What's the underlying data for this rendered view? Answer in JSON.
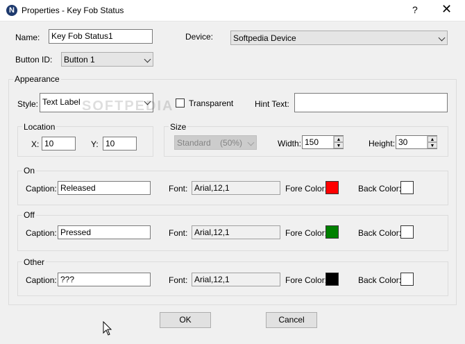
{
  "window": {
    "title": "Properties - Key Fob Status",
    "app_icon_letter": "N",
    "help_glyph": "?",
    "close_glyph": "✕"
  },
  "general": {
    "name_label": "Name:",
    "name_value": "Key Fob Status1",
    "device_label": "Device:",
    "device_value": "Softpedia Device",
    "button_id_label": "Button ID:",
    "button_id_value": "Button 1"
  },
  "appearance": {
    "title": "Appearance",
    "style_label": "Style:",
    "style_value": "Text Label",
    "transparent_label": "Transparent",
    "transparent_checked": false,
    "hint_label": "Hint Text:",
    "hint_value": ""
  },
  "location": {
    "title": "Location",
    "x_label": "X:",
    "x_value": "10",
    "y_label": "Y:",
    "y_value": "10"
  },
  "size": {
    "title": "Size",
    "preset_value": "Standard    (50%)",
    "width_label": "Width:",
    "width_value": "150",
    "height_label": "Height:",
    "height_value": "30"
  },
  "states": [
    {
      "title": "On",
      "caption_label": "Caption:",
      "caption_value": "Released",
      "font_label": "Font:",
      "font_value": "Arial,12,1",
      "fore_label": "Fore Color:",
      "fore_color": "#ff0000",
      "back_label": "Back Color:",
      "back_color": "#ffffff"
    },
    {
      "title": "Off",
      "caption_label": "Caption:",
      "caption_value": "Pressed",
      "font_label": "Font:",
      "font_value": "Arial,12,1",
      "fore_label": "Fore Color:",
      "fore_color": "#008000",
      "back_label": "Back Color:",
      "back_color": "#ffffff"
    },
    {
      "title": "Other",
      "caption_label": "Caption:",
      "caption_value": "???",
      "font_label": "Font:",
      "font_value": "Arial,12,1",
      "fore_label": "Fore Color:",
      "fore_color": "#000000",
      "back_label": "Back Color:",
      "back_color": "#ffffff"
    }
  ],
  "buttons": {
    "ok_label": "OK",
    "cancel_label": "Cancel"
  },
  "watermark": "SOFTPEDIA",
  "icons": {
    "spin_up": "▲",
    "spin_down": "▼"
  }
}
